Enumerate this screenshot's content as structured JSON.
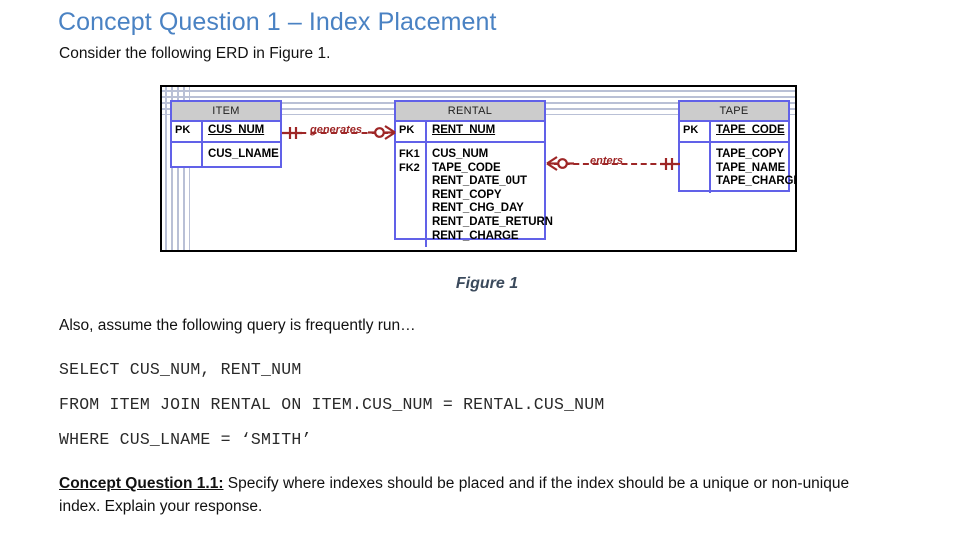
{
  "page": {
    "title": "Concept Question 1 – Index Placement",
    "intro": "Consider the following ERD in Figure 1.",
    "query_intro": "Also, assume the following query is frequently run…",
    "figure_caption": "Figure 1"
  },
  "colors": {
    "title_blue": "#4a82c3",
    "entity_border": "#6161e8",
    "entity_header_fill": "#cccccc",
    "relationship_red": "#9e2626",
    "caption_gray": "#3b4a5c",
    "figure_border": "#000000",
    "grid": "#b9c0d6"
  },
  "erd": {
    "entities": [
      {
        "name": "ITEM",
        "pk_key": "PK",
        "pk_attribute": "CUS_NUM",
        "key_labels": [],
        "attributes": [
          "CUS_LNAME"
        ]
      },
      {
        "name": "RENTAL",
        "pk_key": "PK",
        "pk_attribute": "RENT_NUM",
        "key_labels": [
          "FK1",
          "FK2"
        ],
        "attributes": [
          "CUS_NUM",
          "TAPE_CODE",
          "RENT_DATE_0UT",
          "RENT_COPY",
          "RENT_CHG_DAY",
          "RENT_DATE_RETURN",
          "RENT_CHARGE"
        ]
      },
      {
        "name": "TAPE",
        "pk_key": "PK",
        "pk_attribute": "TAPE_CODE",
        "key_labels": [],
        "attributes": [
          "TAPE_COPY",
          "TAPE_NAME",
          "TAPE_CHARGE"
        ]
      }
    ],
    "relationships": [
      {
        "label": "generates",
        "from": "ITEM",
        "to": "RENTAL",
        "from_cardinality": "one-mandatory",
        "to_cardinality": "zero-or-many"
      },
      {
        "label": "enters",
        "from": "RENTAL",
        "to": "TAPE",
        "from_cardinality": "zero-or-many",
        "to_cardinality": "one-mandatory"
      }
    ]
  },
  "sql": {
    "lines": [
      "SELECT CUS_NUM, RENT_NUM",
      "FROM ITEM JOIN RENTAL ON ITEM.CUS_NUM = RENTAL.CUS_NUM",
      "WHERE CUS_LNAME = ‘SMITH’"
    ]
  },
  "question": {
    "label": "Concept Question 1.1:",
    "text": " Specify where indexes should be placed and if the index should be a unique or non-unique index. Explain your response."
  }
}
